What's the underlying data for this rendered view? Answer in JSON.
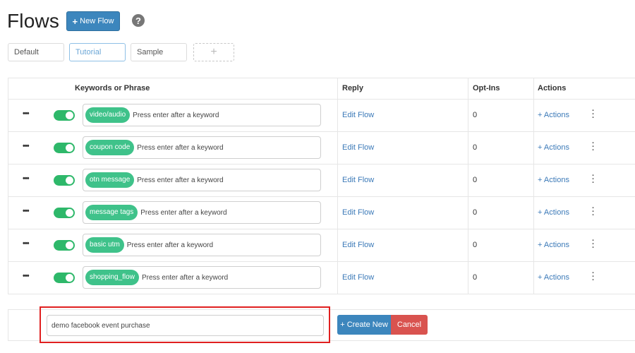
{
  "header": {
    "title": "Flows",
    "new_flow_plus": "+",
    "new_flow_label": "New Flow",
    "help_glyph": "?"
  },
  "tabs": [
    {
      "label": "Default",
      "active": false
    },
    {
      "label": "Tutorial",
      "active": true
    },
    {
      "label": "Sample",
      "active": false
    }
  ],
  "tab_add_glyph": "+",
  "table": {
    "columns": [
      "Keywords or Phrase",
      "Reply",
      "Opt-Ins",
      "Actions"
    ],
    "rows": [
      {
        "menu": "•••",
        "enabled": true,
        "keyword": "video/audio",
        "placeholder": "Press enter after a keyword",
        "reply": "Edit Flow",
        "optins": "0",
        "actions": "+ Actions"
      },
      {
        "menu": "•••",
        "enabled": true,
        "keyword": "coupon code",
        "placeholder": "Press enter after a keyword",
        "reply": "Edit Flow",
        "optins": "0",
        "actions": "+ Actions"
      },
      {
        "menu": "•••",
        "enabled": true,
        "keyword": "otn message",
        "placeholder": "Press enter after a keyword",
        "reply": "Edit Flow",
        "optins": "0",
        "actions": "+ Actions"
      },
      {
        "menu": "•••",
        "enabled": true,
        "keyword": "message tags",
        "placeholder": "Press enter after a keyword",
        "reply": "Edit Flow",
        "optins": "0",
        "actions": "+ Actions"
      },
      {
        "menu": "•••",
        "enabled": true,
        "keyword": "basic utm",
        "placeholder": "Press enter after a keyword",
        "reply": "Edit Flow",
        "optins": "0",
        "actions": "+ Actions"
      },
      {
        "menu": "•••",
        "enabled": true,
        "keyword": "shopping_flow",
        "placeholder": "Press enter after a keyword",
        "reply": "Edit Flow",
        "optins": "0",
        "actions": "+ Actions"
      }
    ]
  },
  "create": {
    "input_value": "demo facebook event purchase",
    "create_label": "+ Create New",
    "cancel_label": "Cancel"
  },
  "colors": {
    "primary": "#3c86bd",
    "toggle_on": "#2eb86a",
    "chip": "#3fc28a",
    "link": "#3c7ab8",
    "danger": "#d9534f",
    "highlight": "#e02020"
  },
  "icons": {
    "help": "question-circle-icon",
    "row_menu": "ellipsis-horizontal-icon",
    "row_kebab": "ellipsis-vertical-icon"
  }
}
